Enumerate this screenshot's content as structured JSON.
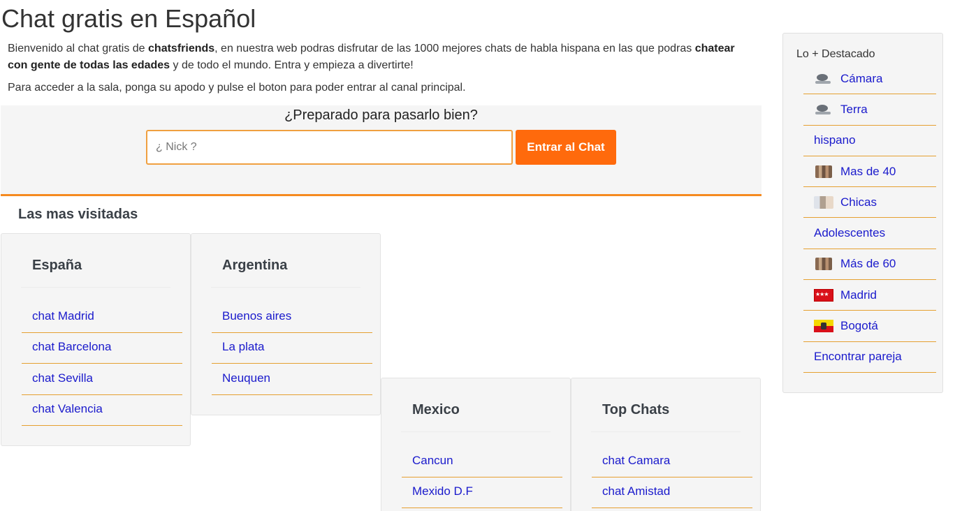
{
  "page": {
    "title": "Chat gratis en Español",
    "intro": {
      "part1": "Bienvenido al chat gratis de ",
      "brand": "chatsfriends",
      "part2": ", en nuestra web podras disfrutar de las 1000 mejores chats de habla hispana en las que podras ",
      "bold2": "chatear con gente de todas las edades",
      "part3": " y de todo el mundo. Entra y empieza a divertirte!"
    },
    "instructions": "Para acceder a la sala, ponga su apodo y pulse el boton para poder entrar al canal principal."
  },
  "login": {
    "title": "¿Preparado para pasarlo bien?",
    "nick_placeholder": "¿ Nick ?",
    "button_label": "Entrar al Chat"
  },
  "section_title": "Las mas visitadas",
  "cards": {
    "espana": {
      "title": "España",
      "links": [
        "chat Madrid",
        "chat Barcelona",
        "chat Sevilla",
        "chat Valencia"
      ]
    },
    "argentina": {
      "title": "Argentina",
      "links": [
        "Buenos aires",
        "La plata",
        "Neuquen"
      ]
    },
    "mexico": {
      "title": "Mexico",
      "links": [
        "Cancun",
        "Mexido D.F"
      ]
    },
    "top": {
      "title": "Top Chats",
      "links": [
        "chat Camara",
        "chat Amistad"
      ]
    }
  },
  "sidebar": {
    "title": "Lo + Destacado",
    "items": [
      {
        "label": "Cámara",
        "icon": "webcam-icon"
      },
      {
        "label": "Terra",
        "icon": "webcam-icon"
      },
      {
        "label": "hispano",
        "icon": ""
      },
      {
        "label": "Mas de 40",
        "icon": "people-icon"
      },
      {
        "label": "Chicas",
        "icon": "girls-icon"
      },
      {
        "label": "Adolescentes",
        "icon": ""
      },
      {
        "label": "Más de 60",
        "icon": "people-icon"
      },
      {
        "label": "Madrid",
        "icon": "madrid-flag-icon"
      },
      {
        "label": "Bogotá",
        "icon": "bogota-flag-icon"
      },
      {
        "label": "Encontrar pareja",
        "icon": ""
      }
    ]
  },
  "colors": {
    "accent": "#ff6a0c",
    "link": "#1a1acc",
    "divider": "#e5a030"
  }
}
